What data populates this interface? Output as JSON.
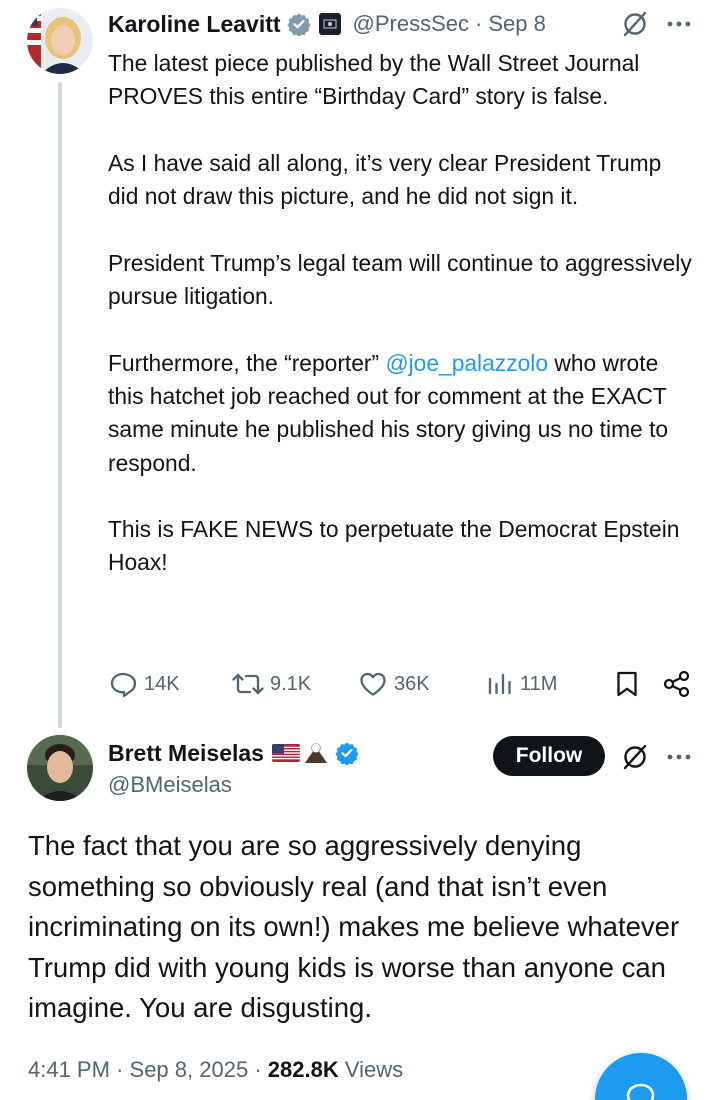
{
  "parent": {
    "name": "Karoline Leavitt",
    "handle": "@PressSec",
    "separator": "·",
    "date": "Sep 8",
    "paragraphs": [
      "The latest piece published by the Wall Street Journal PROVES this entire “Birthday Card” story is false.",
      "As I have said all along, it’s very clear President Trump did not draw this picture, and he did not sign it.",
      "President Trump’s legal team will continue to aggressively pursue litigation."
    ],
    "p4_before": "Furthermore, the “reporter” ",
    "p4_mention": "@joe_palazzolo",
    "p4_after": " who wrote this hatchet job reached out for comment at the EXACT same minute he published his story giving us no time to respond.",
    "p5": "This is FAKE NEWS to perpetuate the Democrat Epstein Hoax!",
    "actions": {
      "replies": "14K",
      "reposts": "9.1K",
      "likes": "36K",
      "views": "11M"
    }
  },
  "reply": {
    "name": "Brett Meiselas",
    "handle": "@BMeiselas",
    "follow_label": "Follow",
    "text": "The fact that you are so aggressively denying something so obviously real (and that isn’t even incriminating on its own!) makes me believe whatever Trump did with young kids is worse than anyone can imagine. You are disgusting.",
    "time": "4:41 PM",
    "sep1": "·",
    "date": "Sep 8, 2025",
    "sep2": "·",
    "views_count": "282.8K",
    "views_label": "Views"
  },
  "colors": {
    "accent": "#1d9bf0",
    "text": "#0f1419",
    "secondary": "#536471",
    "thread_line": "#cfd9de"
  },
  "icons": [
    "verified-badge-icon",
    "affiliate-badge-icon",
    "grok-icon",
    "more-icon",
    "reply-icon",
    "repost-icon",
    "like-icon",
    "views-icon",
    "bookmark-icon",
    "share-icon",
    "us-flag-icon",
    "eagle-icon",
    "compose-icon"
  ]
}
